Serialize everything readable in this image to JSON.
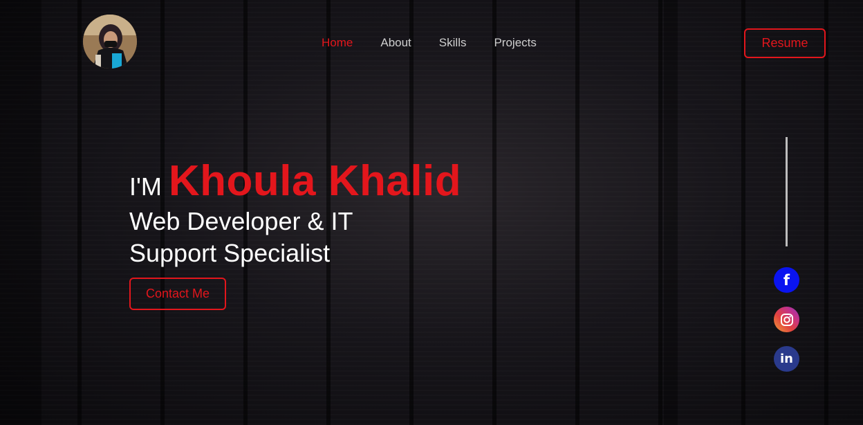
{
  "nav": {
    "items": [
      {
        "label": "Home",
        "active": true
      },
      {
        "label": "About",
        "active": false
      },
      {
        "label": "Skills",
        "active": false
      },
      {
        "label": "Projects",
        "active": false
      }
    ]
  },
  "header": {
    "resume_label": "Resume"
  },
  "hero": {
    "prefix": "I'M",
    "name": "Khoula Khalid",
    "role": "Web Developer & IT Support Specialist",
    "contact_label": "Contact Me"
  },
  "social": [
    {
      "icon": "facebook-icon",
      "glyph": "f"
    },
    {
      "icon": "instagram-icon"
    },
    {
      "icon": "linkedin-icon",
      "glyph": "in"
    }
  ],
  "colors": {
    "accent": "#e3161c",
    "facebook": "#0a14f0",
    "linkedin": "#2a3a8c"
  }
}
